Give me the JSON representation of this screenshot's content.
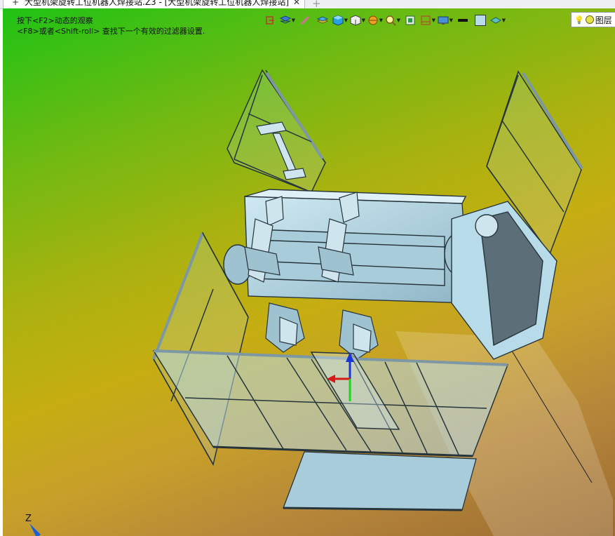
{
  "tab": {
    "title": "大型机架旋转工位机器人焊接站.Z3 - [大型机架旋转工位机器人焊接站]",
    "close_glyph": "✕",
    "plus_glyph": "+"
  },
  "newtab_glyph": "+",
  "hints": {
    "line1": "按下<F2>动态的观察",
    "line2": "<F8>或者<Shift-roll> 查找下一个有效的过滤器设置."
  },
  "toolbar": {
    "icons": [
      "exit-icon",
      "filter-icon",
      "pencil-icon",
      "layers-icon",
      "cube-shaded-icon",
      "cube-wire-icon",
      "render-icon",
      "zoom-icon",
      "view-icon",
      "section-icon",
      "display-icon",
      "line-color-icon",
      "fill-color-icon",
      "eye-icon"
    ],
    "layer_label": "图层"
  },
  "axis": {
    "z_label": "Z"
  },
  "colors": {
    "accent_blue": "#1a5fd6",
    "model_fill": "#b7dbe9",
    "model_edge": "#2a3a44"
  }
}
